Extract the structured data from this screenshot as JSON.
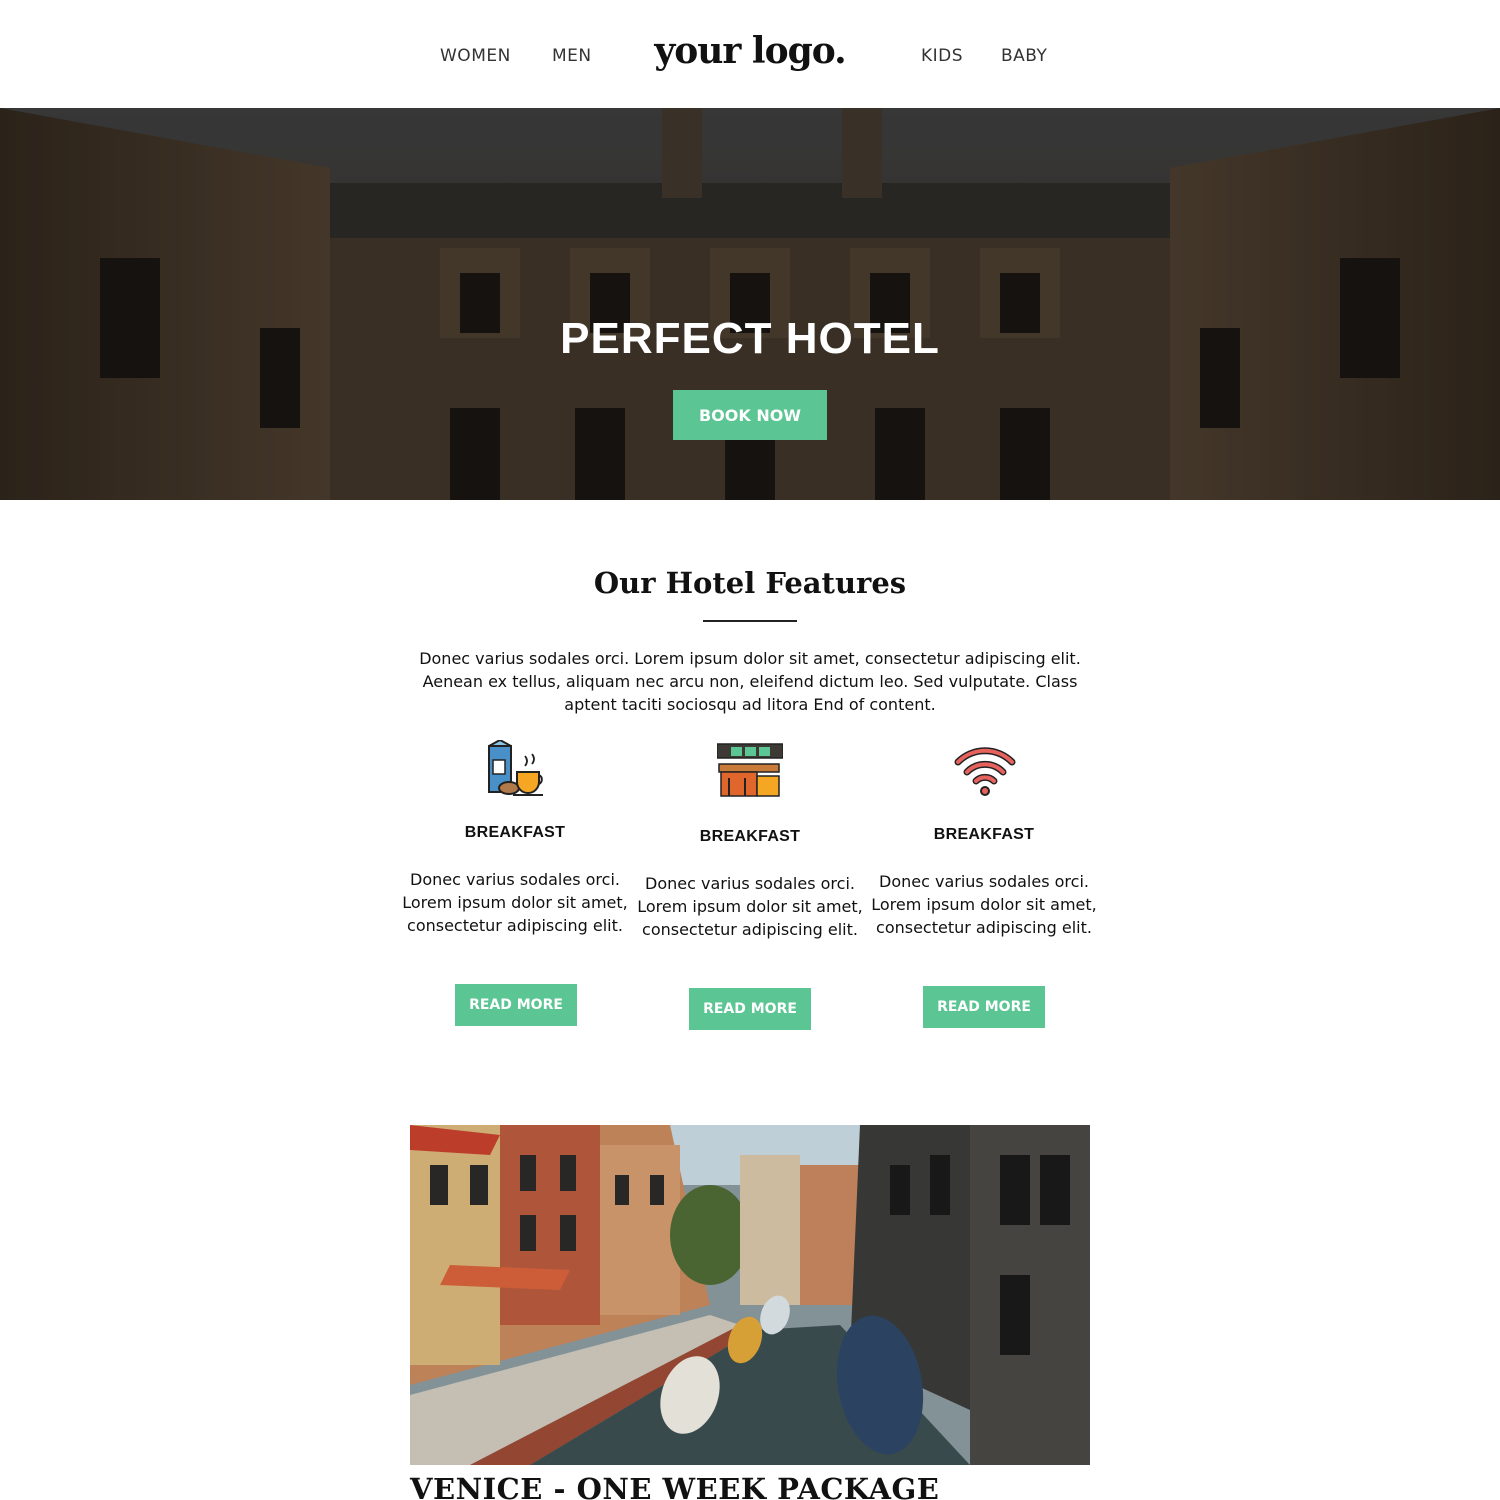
{
  "header": {
    "nav_left": [
      "WOMEN",
      "MEN"
    ],
    "logo": "your logo.",
    "nav_right": [
      "KIDS",
      "BABY"
    ]
  },
  "hero": {
    "title": "PERFECT HOTEL",
    "button_label": "BOOK NOW"
  },
  "features": {
    "title": "Our Hotel Features",
    "description": "Donec varius sodales orci. Lorem ipsum dolor sit amet, consectetur adipiscing elit. Aenean ex tellus, aliquam nec arcu non, eleifend dictum leo. Sed vulputate. Class aptent taciti sociosqu ad litora End of content.",
    "items": [
      {
        "icon": "breakfast-icon",
        "title": "BREAKFAST",
        "text": "Donec varius sodales orci. Lorem ipsum dolor sit amet, consectetur adipiscing elit.",
        "button": "READ MORE"
      },
      {
        "icon": "bar-icon",
        "title": "BREAKFAST",
        "text": "Donec varius sodales orci. Lorem ipsum dolor sit amet, consectetur adipiscing elit.",
        "button": "READ MORE"
      },
      {
        "icon": "wifi-icon",
        "title": "BREAKFAST",
        "text": "Donec varius sodales orci. Lorem ipsum dolor sit amet, consectetur adipiscing elit.",
        "button": "READ MORE"
      }
    ]
  },
  "package": {
    "title": "VENICE - ONE WEEK PACKAGE"
  },
  "colors": {
    "accent": "#5cc594"
  }
}
